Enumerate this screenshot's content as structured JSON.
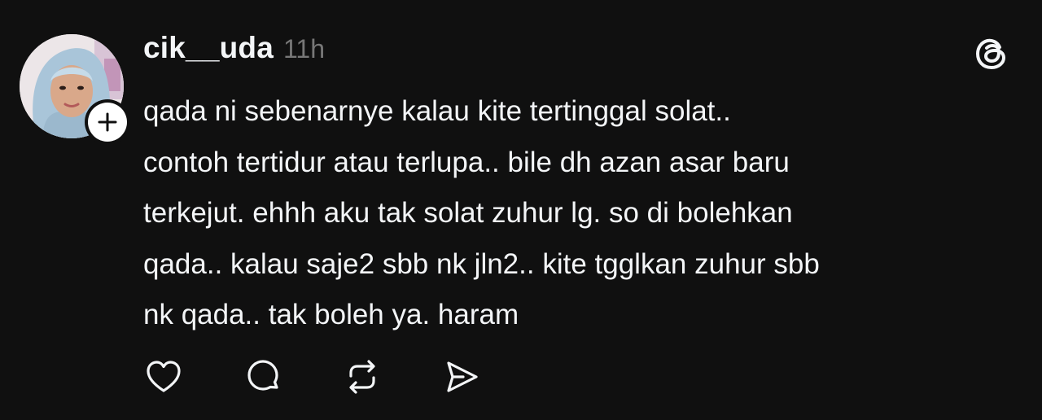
{
  "post": {
    "author": {
      "username": "cik__uda",
      "avatar_icon": "profile-photo-hijab",
      "follow_icon": "plus-icon"
    },
    "timestamp": "11h",
    "app_icon": "threads-logo-icon",
    "text_lines": [
      "qada ni sebenarnye kalau kite tertinggal solat..",
      "contoh tertidur atau terlupa.. bile dh azan asar baru",
      "terkejut. ehhh aku tak solat zuhur lg. so di bolehkan",
      "qada.. kalau saje2 sbb nk jln2.. kite tgglkan zuhur sbb",
      "nk qada.. tak boleh ya. haram"
    ],
    "actions": [
      {
        "name": "like-button",
        "icon": "heart-icon"
      },
      {
        "name": "reply-button",
        "icon": "comment-icon"
      },
      {
        "name": "repost-button",
        "icon": "repost-icon"
      },
      {
        "name": "share-button",
        "icon": "send-icon"
      }
    ]
  },
  "colors": {
    "background": "#101010",
    "primary_text": "#f3f5f7",
    "secondary_text": "#777777",
    "icon": "#f3f5f7",
    "hijab": "#a9c5d9"
  }
}
